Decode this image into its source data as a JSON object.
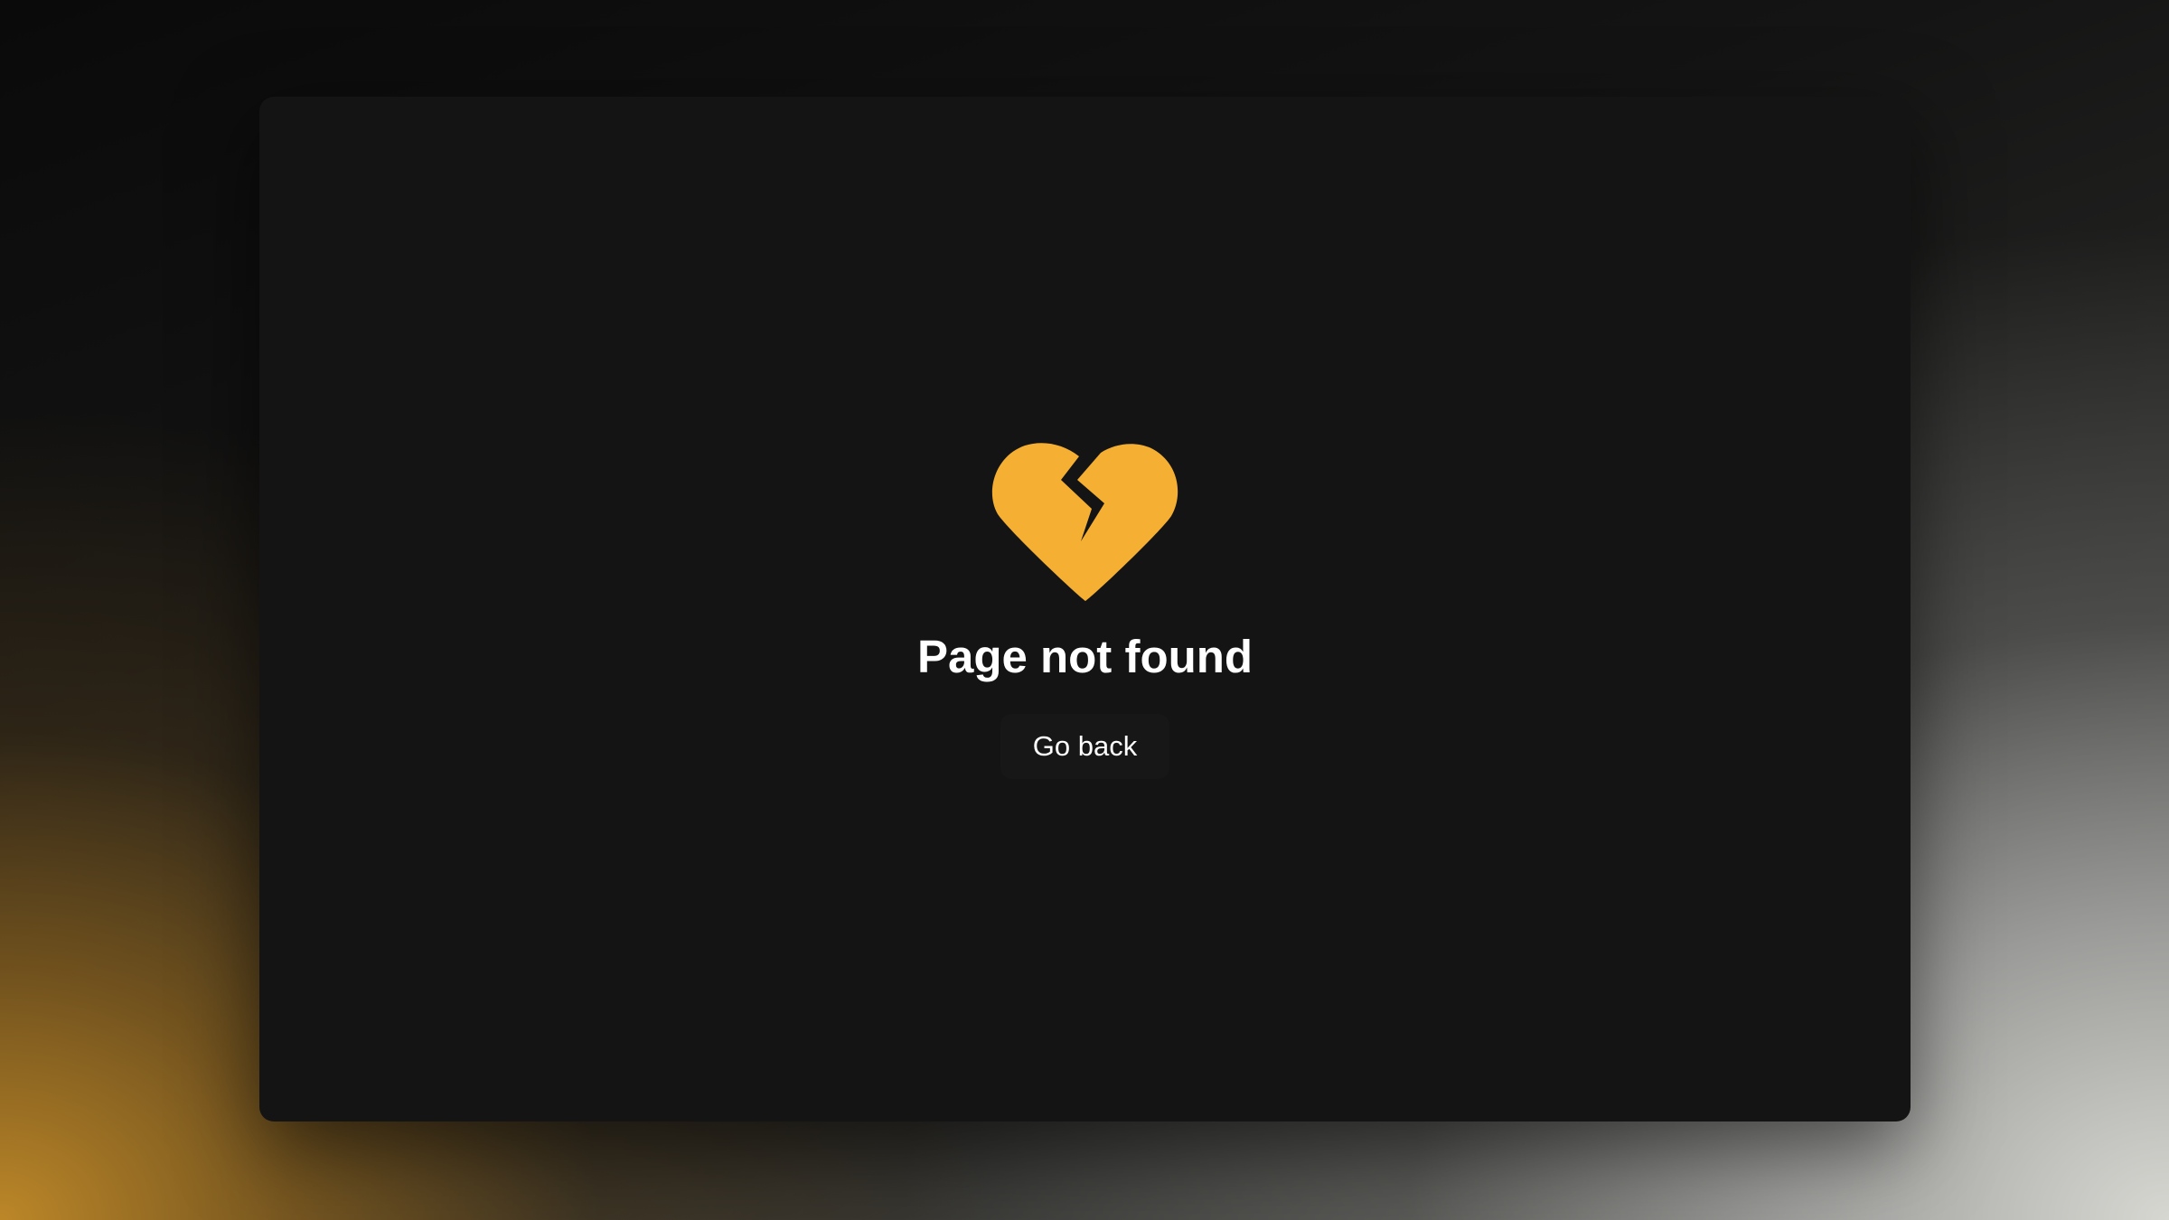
{
  "error_page": {
    "icon": "broken-heart-icon",
    "title": "Page not found",
    "back_button_label": "Go back"
  },
  "colors": {
    "accent": "#F5AF32",
    "panel_background": "#141414",
    "button_background": "#171717",
    "text": "#FFFFFF"
  }
}
